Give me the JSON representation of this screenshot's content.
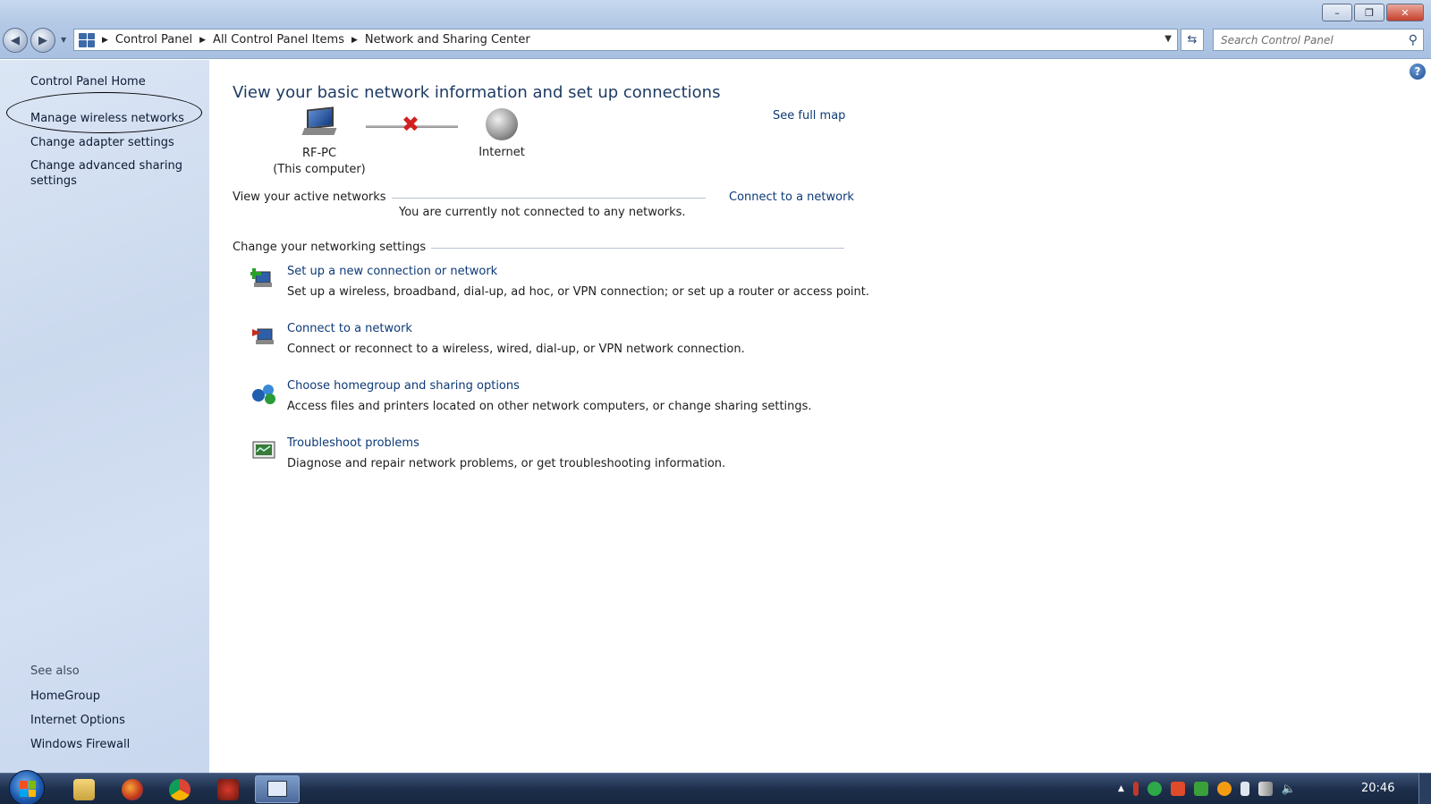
{
  "window": {
    "minimize": "–",
    "maximize": "❐",
    "close": "✕"
  },
  "address": {
    "breadcrumbs": [
      "Control Panel",
      "All Control Panel Items",
      "Network and Sharing Center"
    ],
    "search_placeholder": "Search Control Panel"
  },
  "sidebar": {
    "links": [
      "Control Panel Home",
      "Manage wireless networks",
      "Change adapter settings",
      "Change advanced sharing settings"
    ],
    "see_also_title": "See also",
    "see_also": [
      "HomeGroup",
      "Internet Options",
      "Windows Firewall"
    ]
  },
  "main": {
    "title": "View your basic network information and set up connections",
    "see_full_map": "See full map",
    "map": {
      "computer_name": "RF-PC",
      "computer_sub": "(This computer)",
      "internet": "Internet"
    },
    "active_networks_title": "View your active networks",
    "connect_link": "Connect to a network",
    "not_connected": "You are currently not connected to any networks.",
    "settings_title": "Change your networking settings",
    "tasks": [
      {
        "link": "Set up a new connection or network",
        "desc": "Set up a wireless, broadband, dial-up, ad hoc, or VPN connection; or set up a router or access point.",
        "icon": "new-connection-icon"
      },
      {
        "link": "Connect to a network",
        "desc": "Connect or reconnect to a wireless, wired, dial-up, or VPN network connection.",
        "icon": "connect-network-icon"
      },
      {
        "link": "Choose homegroup and sharing options",
        "desc": "Access files and printers located on other network computers, or change sharing settings.",
        "icon": "homegroup-icon"
      },
      {
        "link": "Troubleshoot problems",
        "desc": "Diagnose and repair network problems, or get troubleshooting information.",
        "icon": "troubleshoot-icon"
      }
    ]
  },
  "taskbar": {
    "clock": "20:46"
  },
  "colors": {
    "link": "#0d3a78",
    "sidebar_bg": "#cbd9ee",
    "taskbar": "#1d2f4c"
  }
}
